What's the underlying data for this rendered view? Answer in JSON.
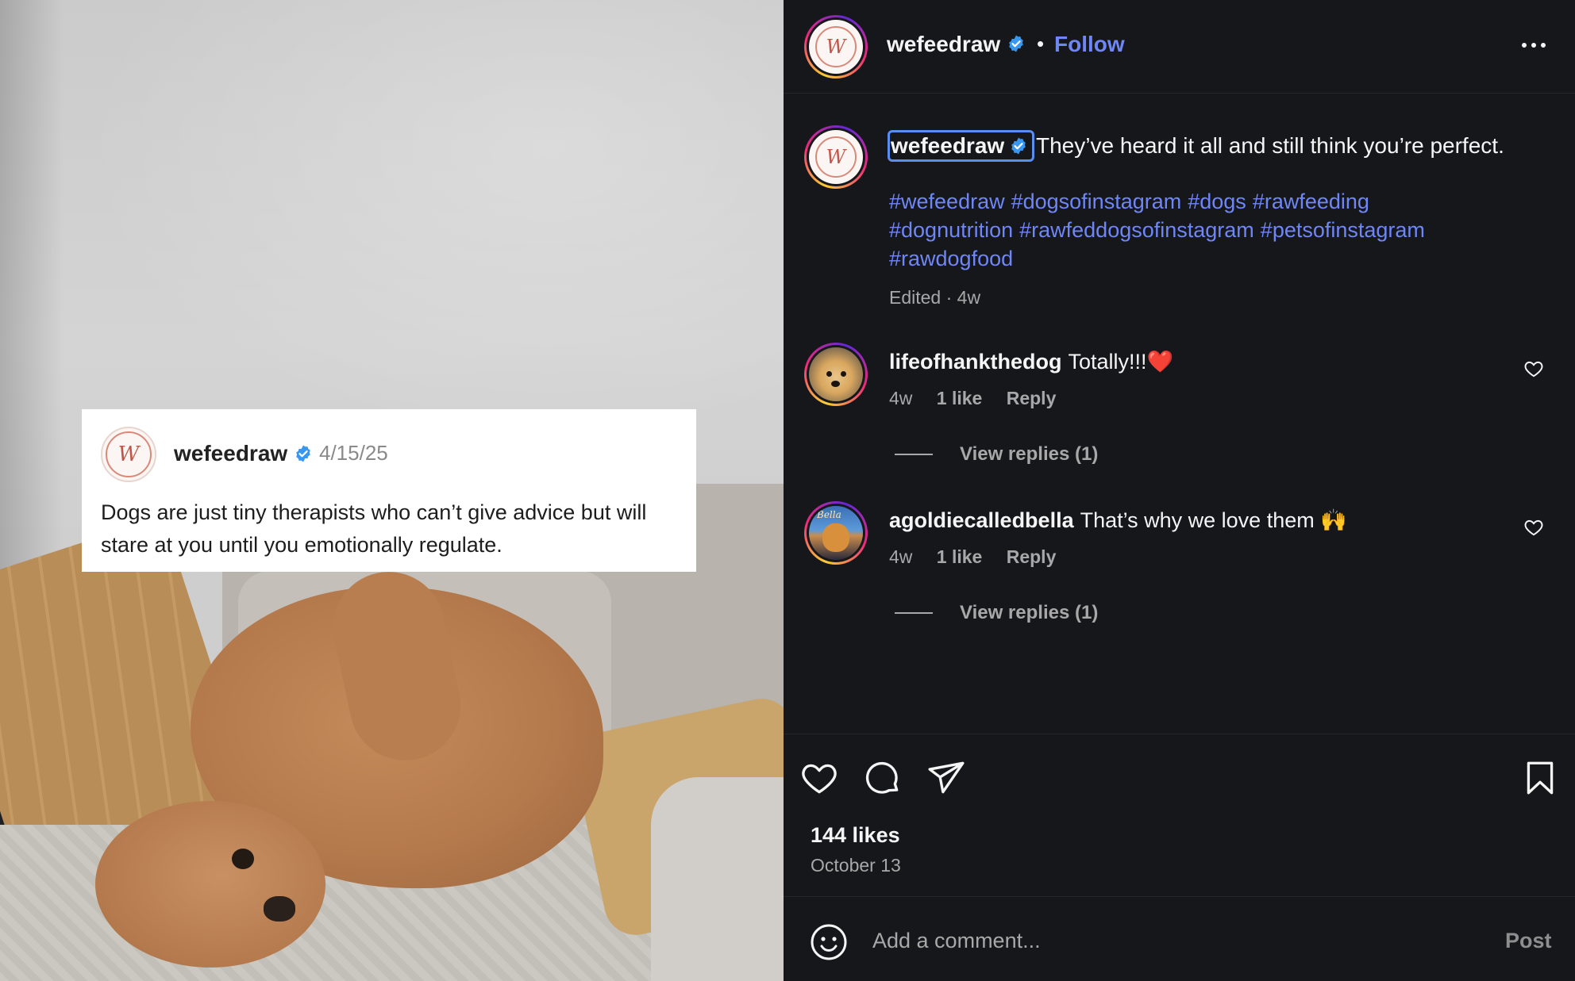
{
  "post": {
    "quote_card": {
      "username": "wefeedraw",
      "date": "4/15/25",
      "text": "Dogs are just tiny therapists who can’t give advice but will stare at you until you emotionally regulate."
    }
  },
  "header": {
    "username": "wefeedraw",
    "separator": "•",
    "follow_label": "Follow"
  },
  "caption": {
    "username": "wefeedraw",
    "text": "They’ve heard it all and still think you’re perfect.",
    "hashtags": [
      "#wefeedraw",
      "#dogsofinstagram",
      "#dogs",
      "#rawfeeding",
      "#dognutrition",
      "#rawfeddogsofinstagram",
      "#petsofinstagram",
      "#rawdogfood"
    ],
    "meta": "Edited · 4w"
  },
  "comments": [
    {
      "username": "lifeofhankthedog",
      "text": "Totally!!!❤️",
      "time": "4w",
      "likes": "1 like",
      "reply_label": "Reply",
      "view_replies": "View replies (1)"
    },
    {
      "username": "agoldiecalledbella",
      "text": "That’s why we love them 🙌",
      "time": "4w",
      "likes": "1 like",
      "reply_label": "Reply",
      "view_replies": "View replies (1)"
    }
  ],
  "engagement": {
    "likes": "144 likes",
    "date": "October 13"
  },
  "comment_bar": {
    "placeholder": "Add a comment...",
    "post_label": "Post"
  },
  "colors": {
    "background": "#16171b",
    "link_blue": "#6f86f7",
    "verified_blue": "#3897f0",
    "muted_text": "#a8a8a8"
  },
  "icons": {
    "like": "heart-icon",
    "comment": "comment-bubble-icon",
    "share": "send-icon",
    "save": "bookmark-icon",
    "more": "more-options-icon",
    "emoji": "emoji-icon",
    "verified": "verified-badge-icon"
  }
}
